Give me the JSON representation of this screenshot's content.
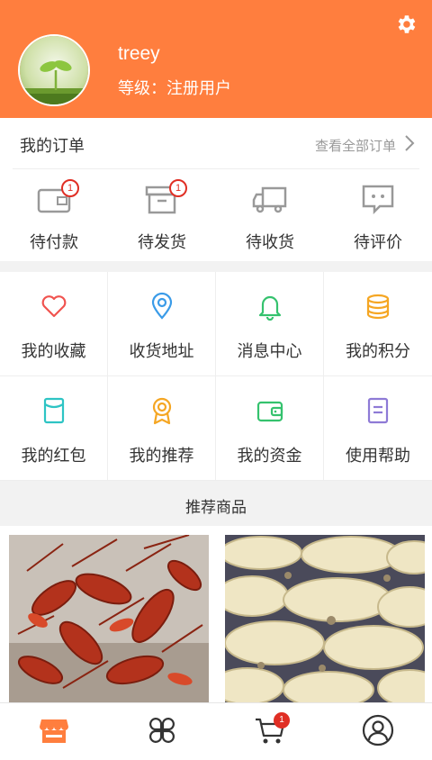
{
  "profile": {
    "username": "treey",
    "level_text": "等级：注册用户"
  },
  "icons": {
    "settings": "gear-icon",
    "avatar": "seedling-photo"
  },
  "orders": {
    "title": "我的订单",
    "view_all": "查看全部订单",
    "items": [
      {
        "label": "待付款",
        "icon": "wallet-icon",
        "badge": "1"
      },
      {
        "label": "待发货",
        "icon": "box-icon",
        "badge": "1"
      },
      {
        "label": "待收货",
        "icon": "truck-icon",
        "badge": ""
      },
      {
        "label": "待评价",
        "icon": "chat-icon",
        "badge": ""
      }
    ]
  },
  "services": [
    {
      "label": "我的收藏",
      "icon": "heart-icon",
      "color": "#f0534f"
    },
    {
      "label": "收货地址",
      "icon": "location-icon",
      "color": "#3a9be8"
    },
    {
      "label": "消息中心",
      "icon": "bell-icon",
      "color": "#35c26e"
    },
    {
      "label": "我的积分",
      "icon": "coins-icon",
      "color": "#f5a623"
    },
    {
      "label": "我的红包",
      "icon": "red-packet-icon",
      "color": "#2ec4c4"
    },
    {
      "label": "我的推荐",
      "icon": "award-icon",
      "color": "#f5a623"
    },
    {
      "label": "我的资金",
      "icon": "wallet-icon",
      "color": "#35c26e"
    },
    {
      "label": "使用帮助",
      "icon": "document-icon",
      "color": "#8e7ad6"
    }
  ],
  "recommend": {
    "title": "推荐商品",
    "products": [
      {
        "image": "crayfish-photo"
      },
      {
        "image": "lotus-root-photo"
      }
    ]
  },
  "tabbar": {
    "items": [
      {
        "icon": "store-icon",
        "active": true
      },
      {
        "icon": "category-icon",
        "active": false
      },
      {
        "icon": "cart-icon",
        "badge": "1",
        "active": false
      },
      {
        "icon": "profile-icon",
        "active": false
      }
    ],
    "active_color": "#ff7e3e"
  },
  "colors": {
    "brand": "#ff7e3e",
    "badge": "#e02e24"
  }
}
